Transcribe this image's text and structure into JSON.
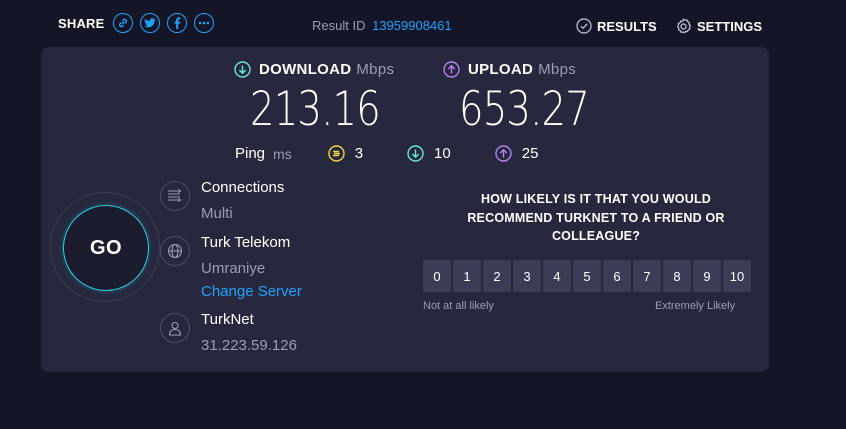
{
  "header": {
    "share_label": "SHARE",
    "share_icons": [
      "link-icon",
      "twitter-icon",
      "facebook-icon",
      "more-icon"
    ],
    "result_label": "Result ID",
    "result_id": "13959908461",
    "results_label": "RESULTS",
    "settings_label": "SETTINGS"
  },
  "download": {
    "label": "DOWNLOAD",
    "unit": "Mbps",
    "value": "213.16",
    "color": "#6ae5dd"
  },
  "upload": {
    "label": "UPLOAD",
    "unit": "Mbps",
    "value": "653.27",
    "color": "#b782f5"
  },
  "ping": {
    "label": "Ping",
    "unit": "ms",
    "idle": "3",
    "download": "10",
    "upload": "25",
    "idle_color": "#f5d742"
  },
  "go": {
    "label": "GO",
    "ring_color": "#22d3e8"
  },
  "connections": {
    "title": "Connections",
    "value": "Multi"
  },
  "server": {
    "name": "Turk Telekom",
    "location": "Umraniye",
    "change_link": "Change Server"
  },
  "isp": {
    "name": "TurkNet",
    "ip": "31.223.59.126"
  },
  "survey": {
    "question": "HOW LIKELY IS IT THAT YOU WOULD RECOMMEND TURKNET TO A FRIEND OR COLLEAGUE?",
    "scale": [
      "0",
      "1",
      "2",
      "3",
      "4",
      "5",
      "6",
      "7",
      "8",
      "9",
      "10"
    ],
    "low_label": "Not at all likely",
    "high_label": "Extremely Likely"
  },
  "colors": {
    "accent_blue": "#1ea3ff",
    "background": "#141526",
    "card": "#27283d"
  }
}
